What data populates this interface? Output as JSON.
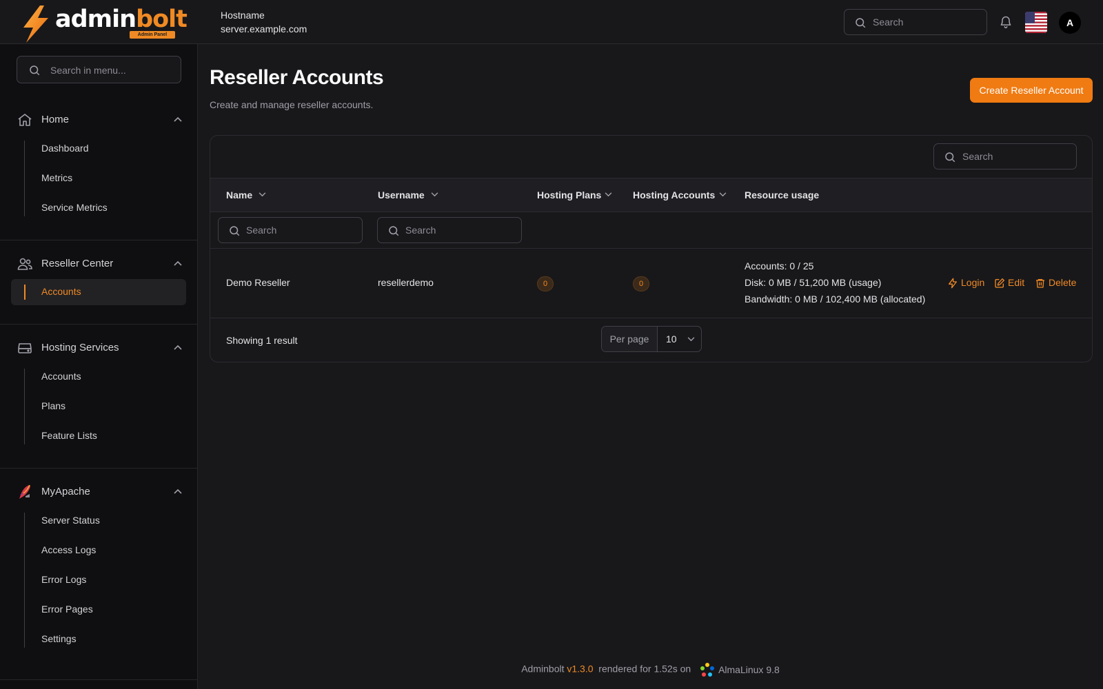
{
  "brand": {
    "name_primary": "admin",
    "name_accent": "bolt",
    "badge": "Admin Panel",
    "accent_color": "#f08a24"
  },
  "header": {
    "hostname_label": "Hostname",
    "hostname_value": "server.example.com",
    "search_placeholder": "Search",
    "avatar_initial": "A",
    "language_flag": "us-flag-icon"
  },
  "sidebar": {
    "search_placeholder": "Search in menu...",
    "groups": [
      {
        "label": "Home",
        "icon": "home-icon",
        "items": [
          "Dashboard",
          "Metrics",
          "Service Metrics"
        ]
      },
      {
        "label": "Reseller Center",
        "icon": "users-icon",
        "items": [
          "Accounts"
        ],
        "active_item": "Accounts"
      },
      {
        "label": "Hosting Services",
        "icon": "server-icon",
        "items": [
          "Accounts",
          "Plans",
          "Feature Lists"
        ]
      },
      {
        "label": "MyApache",
        "icon": "apache-feather-icon",
        "items": [
          "Server Status",
          "Access Logs",
          "Error Logs",
          "Error Pages",
          "Settings"
        ]
      }
    ]
  },
  "main": {
    "title": "Reseller Accounts",
    "subtitle": "Create and manage reseller accounts.",
    "create_button": "Create Reseller Account",
    "table": {
      "search_placeholder": "Search",
      "columns": [
        "Name",
        "Username",
        "Hosting Plans",
        "Hosting Accounts",
        "Resource usage"
      ],
      "filter_placeholder": "Search",
      "rows": [
        {
          "name": "Demo Reseller",
          "username": "resellerdemo",
          "hosting_plans": "0",
          "hosting_accounts": "0",
          "usage": [
            "Accounts: 0 / 25",
            "Disk: 0 MB / 51,200 MB (usage)",
            "Bandwidth: 0 MB / 102,400 MB (allocated)"
          ],
          "actions": [
            "Login",
            "Edit",
            "Delete"
          ]
        }
      ],
      "showing": "Showing 1 result",
      "per_page_label": "Per page",
      "per_page_value": "10"
    }
  },
  "footer": {
    "product": "Adminbolt",
    "version": "v1.3.0",
    "rendered": "rendered for 1.52s on",
    "os": "AlmaLinux 9.8"
  }
}
